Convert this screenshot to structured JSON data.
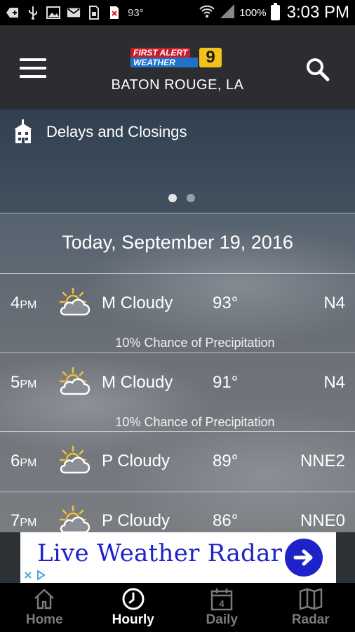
{
  "status_bar": {
    "temperature": "93°",
    "battery_percent": "100%",
    "time": "3:03 PM"
  },
  "header": {
    "logo_first_alert": "FIRST ALERT",
    "logo_weather": "WEATHER",
    "logo_channel": "9",
    "location": "BATON ROUGE, LA"
  },
  "alerts": {
    "label": "Delays and Closings",
    "pages": 2,
    "active_page": 1
  },
  "date_heading": "Today, September 19, 2016",
  "hourly": [
    {
      "hour": "4",
      "period": "PM",
      "condition": "M Cloudy",
      "temp": "93°",
      "wind": "N4",
      "precip": "10% Chance of Precipitation",
      "icon": "partly-cloudy-sun-icon"
    },
    {
      "hour": "5",
      "period": "PM",
      "condition": "M Cloudy",
      "temp": "91°",
      "wind": "N4",
      "precip": "10% Chance of Precipitation",
      "icon": "partly-cloudy-sun-icon"
    },
    {
      "hour": "6",
      "period": "PM",
      "condition": "P Cloudy",
      "temp": "89°",
      "wind": "NNE2",
      "precip": "",
      "icon": "partly-cloudy-sun-icon"
    },
    {
      "hour": "7",
      "period": "PM",
      "condition": "P Cloudy",
      "temp": "86°",
      "wind": "NNE0",
      "precip": "",
      "icon": "partly-cloudy-sun-icon"
    }
  ],
  "ad": {
    "text": "Live Weather Radar"
  },
  "bottom_nav": [
    {
      "label": "Home",
      "icon": "home-icon",
      "active": false
    },
    {
      "label": "Hourly",
      "icon": "clock-icon",
      "active": true
    },
    {
      "label": "Daily",
      "icon": "calendar-icon",
      "active": false,
      "calendar_number": "4"
    },
    {
      "label": "Radar",
      "icon": "map-icon",
      "active": false
    }
  ],
  "colors": {
    "header_bg": "#2b2d30",
    "ad_text": "#1d23c9",
    "logo_red": "#c41e2a",
    "logo_blue": "#1e73c8",
    "logo_yellow": "#f3c21a"
  }
}
